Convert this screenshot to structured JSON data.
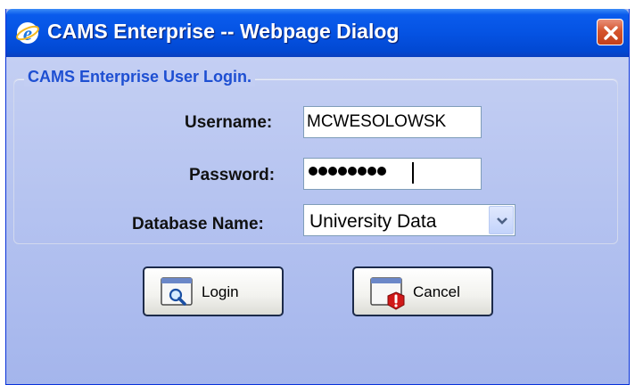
{
  "window": {
    "title": "CAMS Enterprise -- Webpage Dialog",
    "icon": "ie-icon",
    "close_icon": "close-icon"
  },
  "login_form": {
    "legend": "CAMS Enterprise User Login.",
    "username": {
      "label": "Username:",
      "value": "MCWESOLOWSK"
    },
    "password": {
      "label": "Password:",
      "masked_length": 8
    },
    "database": {
      "label": "Database Name:",
      "selected": "University Data"
    }
  },
  "buttons": {
    "login": {
      "label": "Login",
      "icon": "search-window-icon"
    },
    "cancel": {
      "label": "Cancel",
      "icon": "error-window-icon"
    }
  },
  "colors": {
    "titlebar": "#0553e3",
    "legend_text": "#1e4fd2",
    "dialog_background": "#b5c3f0",
    "close_button": "#d5552e"
  }
}
